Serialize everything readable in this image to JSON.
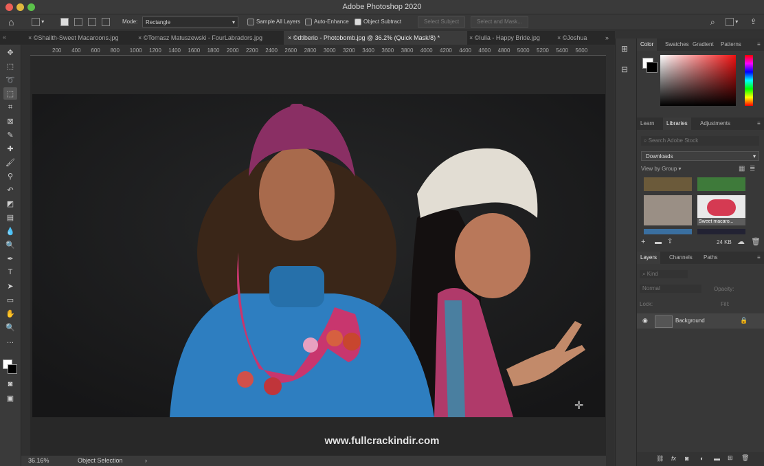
{
  "app": {
    "title": "Adobe Photoshop 2020"
  },
  "options": {
    "mode_label": "Mode:",
    "mode_value": "Rectangle",
    "sample_all_layers": "Sample All Layers",
    "auto_enhance": "Auto-Enhance",
    "object_subtract": "Object Subtract",
    "select_subject": "Select Subject",
    "select_and_mask": "Select and Mask..."
  },
  "tabs": [
    {
      "label": "©Shaiith-Sweet Macaroons.jpg"
    },
    {
      "label": "©Tomasz Matuszewski - FourLabradors.jpg"
    },
    {
      "label": "©dtiberio - Photobomb.jpg @ 36.2% (Quick Mask/8) *"
    },
    {
      "label": "©Iulia - Happy Bride.jpg"
    },
    {
      "label": "©Joshua"
    }
  ],
  "ruler_h": [
    "200",
    "400",
    "600",
    "800",
    "1000",
    "1200",
    "1400",
    "1600",
    "1800",
    "2000",
    "2200",
    "2400",
    "2600",
    "2800",
    "3000",
    "3200",
    "3400",
    "3600",
    "3800",
    "4000",
    "4200",
    "4400",
    "4600",
    "4800",
    "5000",
    "5200",
    "5400",
    "5600"
  ],
  "status": {
    "zoom": "36.16%",
    "info": "Object Selection"
  },
  "panels": {
    "color_tabs": [
      "Color",
      "Swatches",
      "Gradient",
      "Patterns"
    ],
    "lib_tabs": [
      "Learn",
      "Libraries",
      "Adjustments"
    ],
    "search_placeholder": "Search Adobe Stock",
    "library_name": "Downloads",
    "view_by": "View by Group",
    "thumb_label": "Sweet macaro...",
    "lib_size": "24 KB",
    "layer_tabs": [
      "Layers",
      "Channels",
      "Paths"
    ],
    "kind": "Kind",
    "blend": "Normal",
    "opacity": "Opacity:",
    "lock": "Lock:",
    "fill": "Fill:",
    "layer_name": "Background"
  },
  "watermark": "www.fullcrackindir.com",
  "colors": {
    "accent": "#4a8cf0",
    "magenta": "#b8356a",
    "teal_sweater": "#2e7ec0"
  }
}
